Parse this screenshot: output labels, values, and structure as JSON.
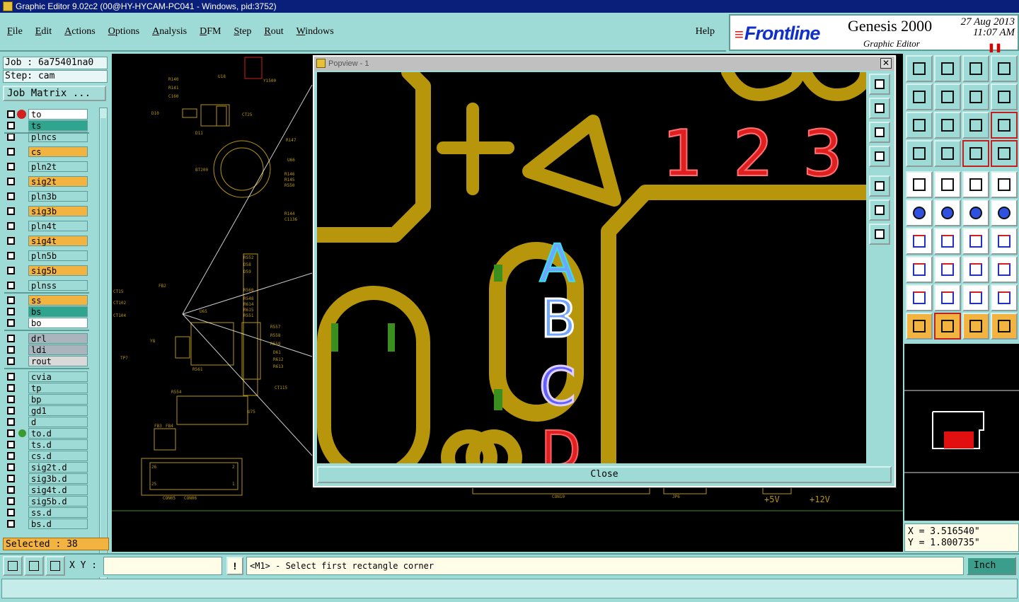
{
  "window": {
    "title": "Graphic Editor 9.02c2 (00@HY-HYCAM-PC041 - Windows, pid:3752)"
  },
  "menu": [
    "File",
    "Edit",
    "Actions",
    "Options",
    "Analysis",
    "DFM",
    "Step",
    "Rout",
    "Windows"
  ],
  "help_label": "Help",
  "brand": {
    "logo": "Frontline",
    "product": "Genesis 2000",
    "subtitle": "Graphic Editor",
    "date": "27 Aug 2013",
    "time": "11:07 AM"
  },
  "job": {
    "job_label": "Job : 6a75401na0",
    "step_label": "Step: cam",
    "matrix_button": "Job Matrix ..."
  },
  "layers": [
    {
      "name": "to",
      "color": "#ffffff",
      "state": "edit"
    },
    {
      "name": "ts",
      "color": "#2fa58f"
    },
    {
      "name": "plncs",
      "color": "#9fdbd6"
    },
    {
      "name": "cs",
      "color": "#f3b340"
    },
    {
      "name": "pln2t",
      "color": "#9fdbd6"
    },
    {
      "name": "sig2t",
      "color": "#f3b340"
    },
    {
      "name": "pln3b",
      "color": "#9fdbd6"
    },
    {
      "name": "sig3b",
      "color": "#f3b340"
    },
    {
      "name": "pln4t",
      "color": "#9fdbd6"
    },
    {
      "name": "sig4t",
      "color": "#f3b340"
    },
    {
      "name": "pln5b",
      "color": "#9fdbd6"
    },
    {
      "name": "sig5b",
      "color": "#f3b340"
    },
    {
      "name": "plnss",
      "color": "#9fdbd6"
    },
    {
      "name": "ss",
      "color": "#f3b340"
    },
    {
      "name": "bs",
      "color": "#2fa58f"
    },
    {
      "name": "bo",
      "color": "#ffffff"
    },
    {
      "name": "drl",
      "color": "#a9b4bc"
    },
    {
      "name": "ldi",
      "color": "#a9b4bc"
    },
    {
      "name": "rout",
      "color": "#d9d9d9"
    },
    {
      "name": "cvia",
      "color": "#9fdbd6"
    },
    {
      "name": "tp",
      "color": "#9fdbd6"
    },
    {
      "name": "bp",
      "color": "#9fdbd6"
    },
    {
      "name": "gd1",
      "color": "#9fdbd6"
    },
    {
      "name": "d",
      "color": "#9fdbd6"
    },
    {
      "name": "to.d",
      "color": "#9fdbd6",
      "state": "affected"
    },
    {
      "name": "ts.d",
      "color": "#9fdbd6"
    },
    {
      "name": "cs.d",
      "color": "#9fdbd6"
    },
    {
      "name": "sig2t.d",
      "color": "#9fdbd6"
    },
    {
      "name": "sig3b.d",
      "color": "#9fdbd6"
    },
    {
      "name": "sig4t.d",
      "color": "#9fdbd6"
    },
    {
      "name": "sig5b.d",
      "color": "#9fdbd6"
    },
    {
      "name": "ss.d",
      "color": "#9fdbd6"
    },
    {
      "name": "bs.d",
      "color": "#9fdbd6"
    }
  ],
  "selected_label": "Selected : 38",
  "board": {
    "labels": [
      "R140",
      "R141",
      "C160",
      "U18",
      "D10",
      "Y1500",
      "D11",
      "CT25",
      "BT200",
      "R147",
      "U66",
      "R146",
      "R145",
      "R550",
      "R144",
      "C1136",
      "R552",
      "D58",
      "D59",
      "R560",
      "R548",
      "R614",
      "R615",
      "R551",
      "R557",
      "R558",
      "R559",
      "D61",
      "R612",
      "R613",
      "CT15",
      "CT102",
      "CT104",
      "FB2",
      "U65",
      "Y8",
      "TP7",
      "R561",
      "R554",
      "CT115",
      "U75",
      "FB3",
      "FB4",
      "CON05",
      "CON06",
      "CON10",
      "JP6",
      "+5V",
      "+12V",
      "26",
      "25",
      "2",
      "1"
    ]
  },
  "popview": {
    "title": "Popview - 1",
    "close_x": "✕",
    "close_button": "Close",
    "numbers": [
      "1",
      "2",
      "3"
    ],
    "letters": [
      "A",
      "B",
      "C",
      "D"
    ]
  },
  "coords": {
    "x_label": "X = 3.516540\"",
    "y_label": "Y = 1.800735\""
  },
  "xy_label": "X Y :",
  "xy_value": "",
  "bang_label": "!",
  "prompt": "<M1> - Select first rectangle corner",
  "units_button": "Inch",
  "colors": {
    "panel": "#9fdbd6",
    "copper": "#b8960c",
    "pad": "#3a8f1e",
    "silk_red": "#e02020",
    "selected_orange": "#f3b340"
  }
}
